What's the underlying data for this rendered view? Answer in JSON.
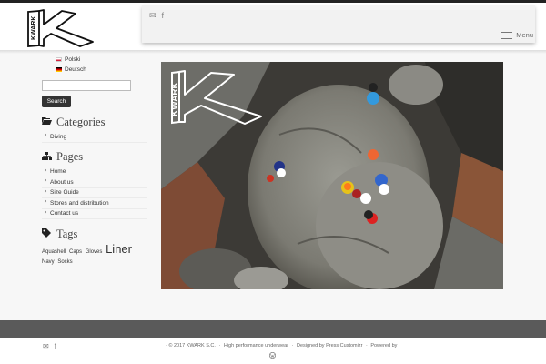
{
  "header": {
    "logo_text": "KWARK",
    "social": {
      "mail_icon": "✉",
      "facebook_icon": "f"
    },
    "menu_label": "Menu"
  },
  "sidebar": {
    "languages": [
      {
        "label": "Polski"
      },
      {
        "label": "Deutsch"
      }
    ],
    "search": {
      "placeholder": "",
      "button_label": "Search"
    },
    "categories": {
      "title": "Categories",
      "items": [
        "Diving"
      ]
    },
    "pages": {
      "title": "Pages",
      "items": [
        "Home",
        "About us",
        "Size Guide",
        "Stores and distribution",
        "Contact us"
      ]
    },
    "tags": {
      "title": "Tags",
      "items": [
        "Aquashell",
        "Caps",
        "Gloves",
        "Liner",
        "Navy",
        "Socks"
      ]
    }
  },
  "hero": {
    "logo_text": "KWARK"
  },
  "footer": {
    "copyright": "© 2017 KWARK S.C.",
    "tagline": "High performance underwear",
    "designed_by": "Designed by Press Customizr",
    "powered_by": "Powered by",
    "sep": "·"
  }
}
